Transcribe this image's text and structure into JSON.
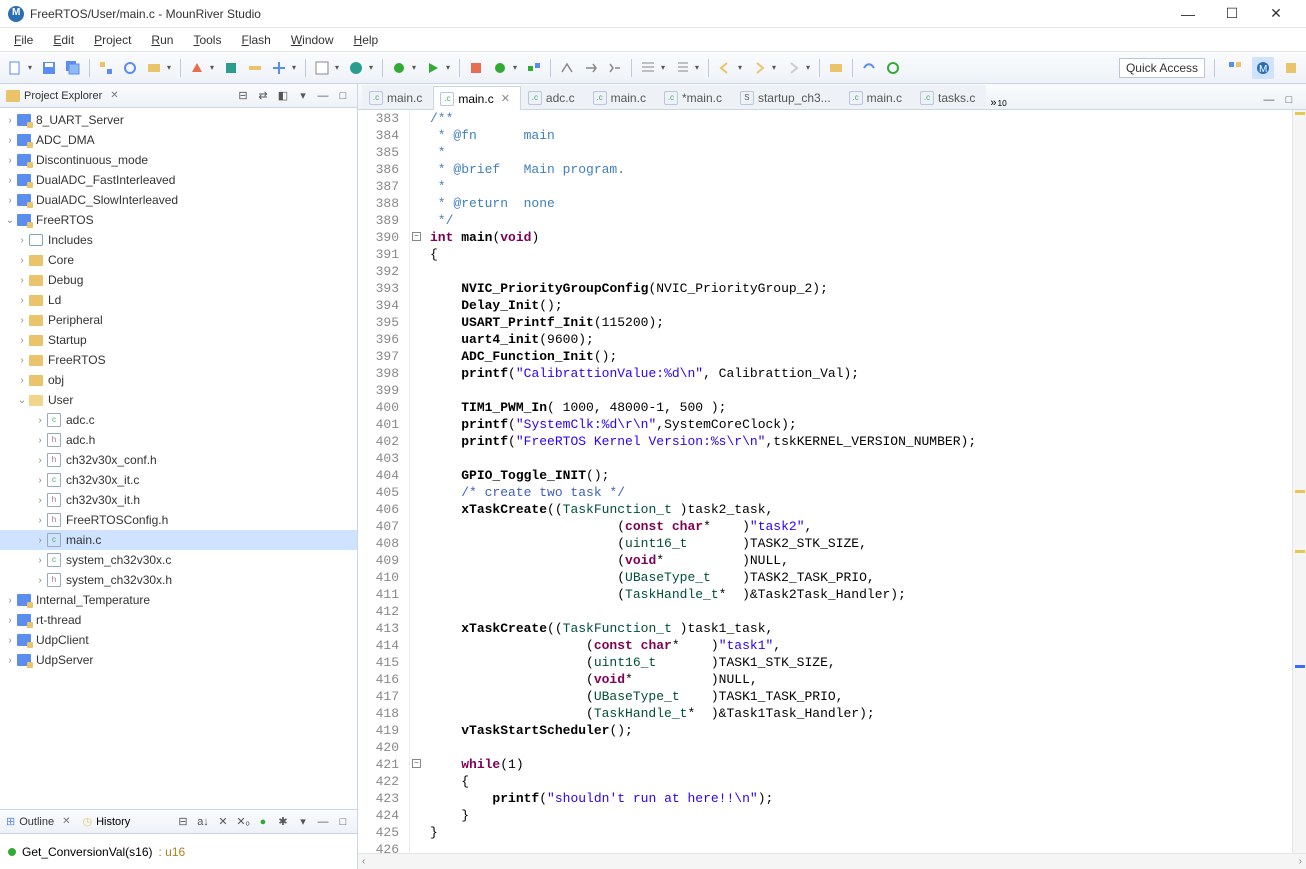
{
  "title": "FreeRTOS/User/main.c - MounRiver Studio",
  "menus": [
    "File",
    "Edit",
    "Project",
    "Run",
    "Tools",
    "Flash",
    "Window",
    "Help"
  ],
  "quick_access": "Quick Access",
  "project_explorer": {
    "title": "Project Explorer",
    "projects": [
      {
        "name": "8_UART_Server",
        "kind": "proj"
      },
      {
        "name": "ADC_DMA",
        "kind": "proj"
      },
      {
        "name": "Discontinuous_mode",
        "kind": "proj"
      },
      {
        "name": "DualADC_FastInterleaved",
        "kind": "proj"
      },
      {
        "name": "DualADC_SlowInterleaved",
        "kind": "proj"
      }
    ],
    "open_project": {
      "name": "FreeRTOS",
      "children": [
        {
          "name": "Includes",
          "kind": "inc"
        },
        {
          "name": "Core",
          "kind": "fold"
        },
        {
          "name": "Debug",
          "kind": "fold"
        },
        {
          "name": "Ld",
          "kind": "fold"
        },
        {
          "name": "Peripheral",
          "kind": "fold"
        },
        {
          "name": "Startup",
          "kind": "fold"
        },
        {
          "name": "FreeRTOS",
          "kind": "fold"
        },
        {
          "name": "obj",
          "kind": "fold"
        }
      ],
      "user": {
        "name": "User",
        "files": [
          {
            "name": "adc.c",
            "kind": "c"
          },
          {
            "name": "adc.h",
            "kind": "h"
          },
          {
            "name": "ch32v30x_conf.h",
            "kind": "h"
          },
          {
            "name": "ch32v30x_it.c",
            "kind": "c"
          },
          {
            "name": "ch32v30x_it.h",
            "kind": "h"
          },
          {
            "name": "FreeRTOSConfig.h",
            "kind": "h"
          },
          {
            "name": "main.c",
            "kind": "c",
            "sel": true
          },
          {
            "name": "system_ch32v30x.c",
            "kind": "c"
          },
          {
            "name": "system_ch32v30x.h",
            "kind": "h"
          }
        ]
      }
    },
    "trailing": [
      {
        "name": "Internal_Temperature",
        "kind": "proj"
      },
      {
        "name": "rt-thread",
        "kind": "proj"
      },
      {
        "name": "UdpClient",
        "kind": "proj"
      },
      {
        "name": "UdpServer",
        "kind": "proj"
      }
    ]
  },
  "outline": {
    "tab1": "Outline",
    "tab2": "History",
    "item": "Get_ConversionVal(s16)",
    "type": ": u16"
  },
  "tabs": [
    {
      "label": "main.c",
      "kind": "c"
    },
    {
      "label": "main.c",
      "kind": "c",
      "active": true
    },
    {
      "label": "adc.c",
      "kind": "c"
    },
    {
      "label": "main.c",
      "kind": "c"
    },
    {
      "label": "*main.c",
      "kind": "c"
    },
    {
      "label": "startup_ch3...",
      "kind": "s"
    },
    {
      "label": "main.c",
      "kind": "c"
    },
    {
      "label": "tasks.c",
      "kind": "c"
    }
  ],
  "tab_overflow": "10",
  "code_first_line": 383,
  "code": [
    {
      "t": "cmt",
      "s": "/**"
    },
    {
      "t": "cmt",
      "s": " * @fn      main"
    },
    {
      "t": "cmt",
      "s": " *"
    },
    {
      "t": "cmt",
      "s": " * @brief   Main program."
    },
    {
      "t": "cmt",
      "s": " *"
    },
    {
      "t": "cmt",
      "s": " * @return  none"
    },
    {
      "t": "cmt",
      "s": " */"
    },
    {
      "t": "decl",
      "s": "int main(void)"
    },
    {
      "t": "plain",
      "s": "{"
    },
    {
      "t": "blank",
      "s": ""
    },
    {
      "t": "call",
      "s": "    NVIC_PriorityGroupConfig(NVIC_PriorityGroup_2);"
    },
    {
      "t": "call",
      "s": "    Delay_Init();"
    },
    {
      "t": "call",
      "s": "    USART_Printf_Init(115200);"
    },
    {
      "t": "call",
      "s": "    uart4_init(9600);"
    },
    {
      "t": "call",
      "s": "    ADC_Function_Init();"
    },
    {
      "t": "printf",
      "s": "    printf(\"CalibrattionValue:%d\\n\", Calibrattion_Val);"
    },
    {
      "t": "blank",
      "s": ""
    },
    {
      "t": "call",
      "s": "    TIM1_PWM_In( 1000, 48000-1, 500 );"
    },
    {
      "t": "printf",
      "s": "    printf(\"SystemClk:%d\\r\\n\",SystemCoreClock);"
    },
    {
      "t": "printf",
      "s": "    printf(\"FreeRTOS Kernel Version:%s\\r\\n\",tskKERNEL_VERSION_NUMBER);"
    },
    {
      "t": "blank",
      "s": ""
    },
    {
      "t": "call",
      "s": "    GPIO_Toggle_INIT();"
    },
    {
      "t": "cmt2",
      "s": "    /* create two task */"
    },
    {
      "t": "task",
      "s": "    xTaskCreate((TaskFunction_t )task2_task,"
    },
    {
      "t": "taskp",
      "s": "                        (const char*    )\"task2\","
    },
    {
      "t": "taskp",
      "s": "                        (uint16_t       )TASK2_STK_SIZE,"
    },
    {
      "t": "taskp",
      "s": "                        (void*          )NULL,"
    },
    {
      "t": "taskp",
      "s": "                        (UBaseType_t    )TASK2_TASK_PRIO,"
    },
    {
      "t": "taskp",
      "s": "                        (TaskHandle_t*  )&Task2Task_Handler);"
    },
    {
      "t": "blank",
      "s": ""
    },
    {
      "t": "task",
      "s": "    xTaskCreate((TaskFunction_t )task1_task,"
    },
    {
      "t": "taskp",
      "s": "                    (const char*    )\"task1\","
    },
    {
      "t": "taskp",
      "s": "                    (uint16_t       )TASK1_STK_SIZE,"
    },
    {
      "t": "taskp",
      "s": "                    (void*          )NULL,"
    },
    {
      "t": "taskp",
      "s": "                    (UBaseType_t    )TASK1_TASK_PRIO,"
    },
    {
      "t": "taskp",
      "s": "                    (TaskHandle_t*  )&Task1Task_Handler);"
    },
    {
      "t": "call",
      "s": "    vTaskStartScheduler();"
    },
    {
      "t": "blank",
      "s": ""
    },
    {
      "t": "while",
      "s": "    while(1)"
    },
    {
      "t": "plain",
      "s": "    {"
    },
    {
      "t": "printf",
      "s": "        printf(\"shouldn't run at here!!\\n\");"
    },
    {
      "t": "plain",
      "s": "    }"
    },
    {
      "t": "plain",
      "s": "}"
    },
    {
      "t": "blank",
      "s": ""
    }
  ]
}
